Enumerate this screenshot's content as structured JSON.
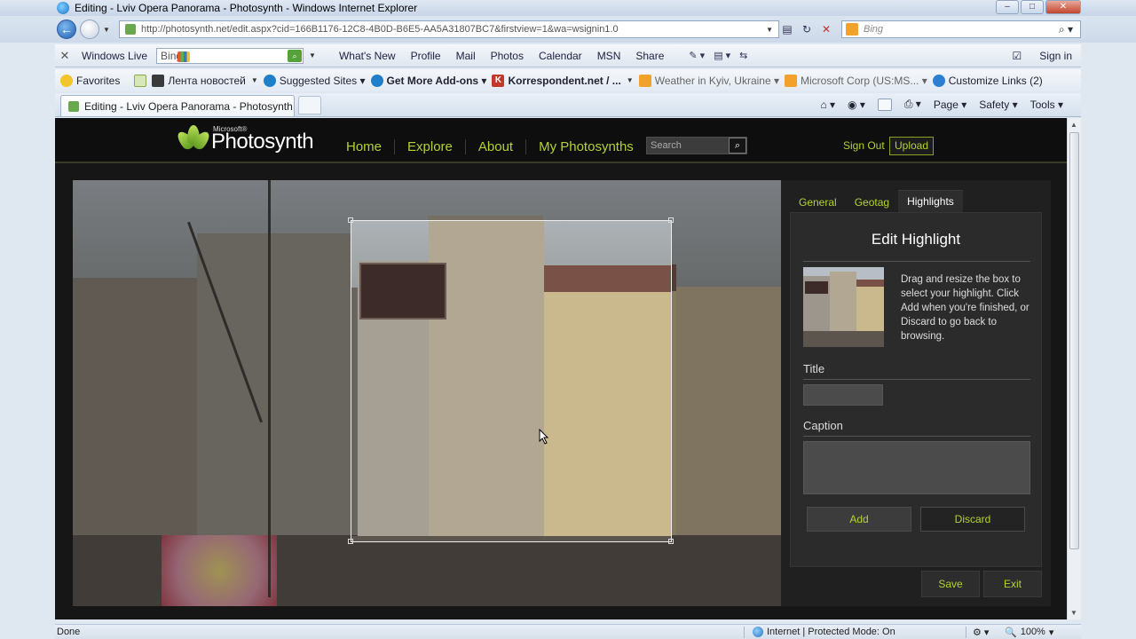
{
  "window": {
    "title": "Editing - Lviv Opera Panorama - Photosynth - Windows Internet Explorer",
    "min": "–",
    "max": "□",
    "close": "✕"
  },
  "address": {
    "url": "http://photosynth.net/edit.aspx?cid=166B1176-12C8-4B0D-B6E5-AA5A31807BC7&firstview=1&wa=wsignin1.0",
    "search_placeholder": "Bing"
  },
  "livebar": {
    "brand": "Windows Live",
    "search_value": "Bing",
    "links": [
      "What's New",
      "Profile",
      "Mail",
      "Photos",
      "Calendar",
      "MSN",
      "Share"
    ],
    "signin": "Sign in"
  },
  "favbar": {
    "favorites": "Favorites",
    "items": [
      {
        "label": "Лента новостей",
        "style": "normal",
        "color": "#3b3b3b"
      },
      {
        "label": "Suggested Sites ▾",
        "style": "normal",
        "color": "#1f7fc9"
      },
      {
        "label": "Get More Add-ons ▾",
        "style": "bold",
        "color": "#1f7fc9"
      },
      {
        "label": "Korrespondent.net / ...",
        "style": "bold",
        "color": "#c0392b"
      },
      {
        "label": "Weather in Kyiv, Ukraine ▾",
        "style": "gray",
        "color": "#f2a22b"
      },
      {
        "label": "Microsoft Corp (US:MS... ▾",
        "style": "gray",
        "color": "#f2a22b"
      },
      {
        "label": "Customize Links (2)",
        "style": "normal",
        "color": "#2d7fd3"
      }
    ]
  },
  "tab": {
    "label": "Editing - Lviv Opera Panorama - Photosynth"
  },
  "cmdbar": {
    "page": "Page ▾",
    "safety": "Safety ▾",
    "tools": "Tools ▾"
  },
  "photosynth": {
    "brand_prefix": "Microsoft®",
    "brand": "Photosynth",
    "nav": [
      "Home",
      "Explore",
      "About",
      "My Photosynths"
    ],
    "search_placeholder": "Search",
    "sign_out": "Sign Out",
    "upload": "Upload"
  },
  "panel": {
    "tabs": [
      "General",
      "Geotag",
      "Highlights"
    ],
    "active_tab": "Highlights",
    "heading": "Edit Highlight",
    "description": "Drag and resize the box to select your highlight. Click Add when you're finished, or Discard to go back to browsing.",
    "title_label": "Title",
    "title_value": "",
    "caption_label": "Caption",
    "caption_value": "",
    "add": "Add",
    "discard": "Discard"
  },
  "footer_buttons": {
    "save": "Save",
    "exit": "Exit"
  },
  "status": {
    "left": "Done",
    "zone": "Internet | Protected Mode: On",
    "zoom": "100%"
  }
}
